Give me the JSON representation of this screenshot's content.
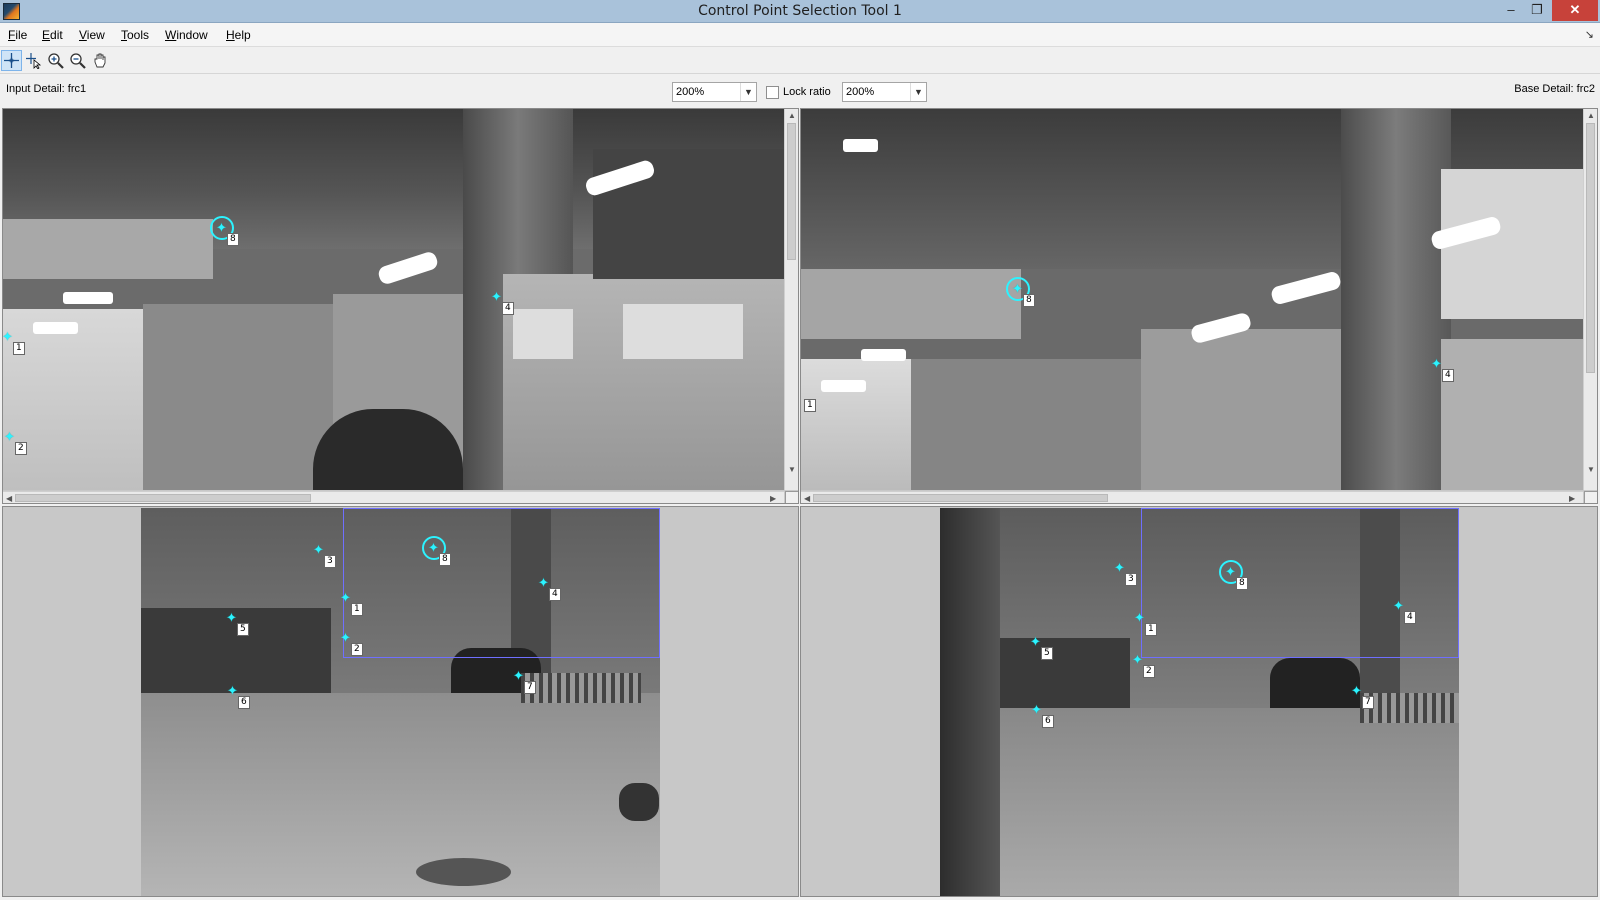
{
  "window": {
    "title": "Control Point Selection Tool 1",
    "minimize": "–",
    "restore": "❐",
    "close": "✕"
  },
  "menu": {
    "items": [
      {
        "underline": "F",
        "rest": "ile"
      },
      {
        "underline": "E",
        "rest": "dit"
      },
      {
        "underline": "V",
        "rest": "iew"
      },
      {
        "underline": "T",
        "rest": "ools"
      },
      {
        "underline": "W",
        "rest": "indow"
      },
      {
        "underline": "H",
        "rest": "elp"
      }
    ],
    "dock_icon": "↘"
  },
  "toolbar": {
    "tools": [
      {
        "name": "add-point-tool-icon",
        "active": true
      },
      {
        "name": "select-point-tool-icon",
        "active": false
      },
      {
        "name": "zoom-in-icon",
        "active": false
      },
      {
        "name": "zoom-out-icon",
        "active": false
      },
      {
        "name": "pan-hand-icon",
        "active": false
      }
    ]
  },
  "detail_header": {
    "input_label": "Input Detail: frc1",
    "base_label": "Base Detail: frc2",
    "input_zoom": "200%",
    "base_zoom": "200%",
    "lock_ratio_label": "Lock ratio",
    "lock_ratio_checked": false
  },
  "control_points": {
    "input_detail": [
      {
        "label": "8",
        "predicted": true
      },
      {
        "label": "4"
      },
      {
        "label": "1"
      },
      {
        "label": "2"
      }
    ],
    "base_detail": [
      {
        "label": "8",
        "predicted": true
      },
      {
        "label": "4"
      },
      {
        "label": "1"
      }
    ],
    "input_overview": [
      {
        "label": "3"
      },
      {
        "label": "8",
        "predicted": true
      },
      {
        "label": "4"
      },
      {
        "label": "1"
      },
      {
        "label": "5"
      },
      {
        "label": "2"
      },
      {
        "label": "7"
      },
      {
        "label": "6"
      }
    ],
    "base_overview": [
      {
        "label": "3"
      },
      {
        "label": "8",
        "predicted": true
      },
      {
        "label": "4"
      },
      {
        "label": "1"
      },
      {
        "label": "5"
      },
      {
        "label": "2"
      },
      {
        "label": "7"
      },
      {
        "label": "6"
      }
    ]
  },
  "colors": {
    "point": "#2cf3ff",
    "detail_rect": "#6f6fff",
    "titlebar": "#a9c2da"
  }
}
